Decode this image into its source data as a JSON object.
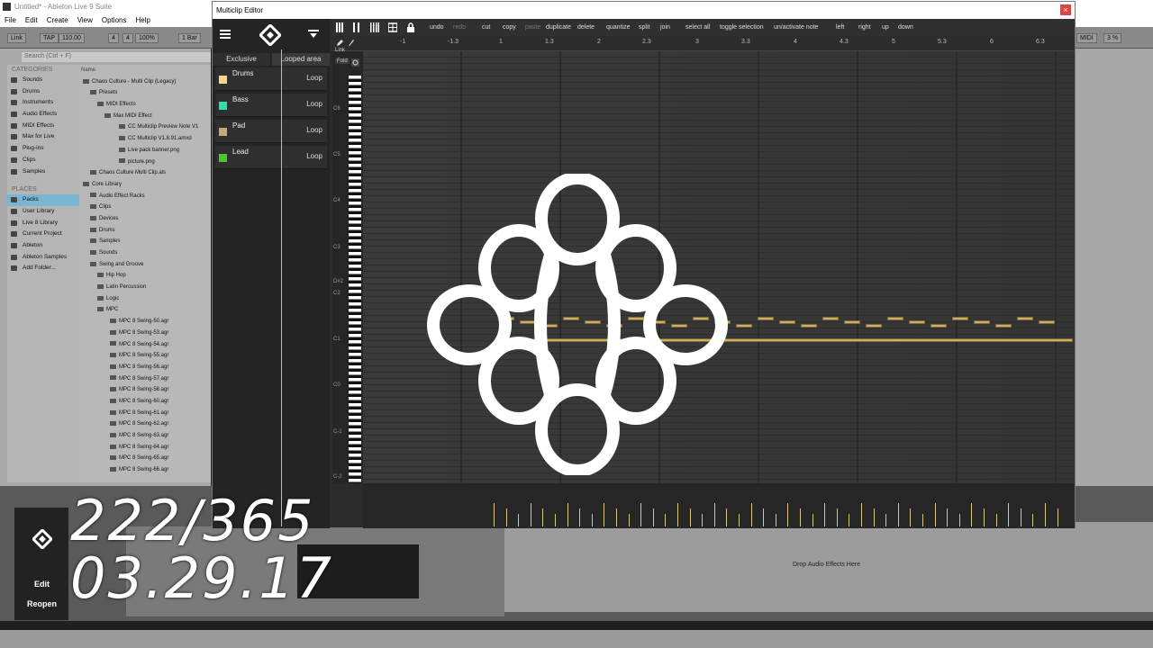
{
  "window": {
    "title": "Untitled* - Ableton Live 9 Suite"
  },
  "menu": [
    "File",
    "Edit",
    "Create",
    "View",
    "Options",
    "Help"
  ],
  "transport": {
    "link": "Link",
    "tap": "TAP",
    "tempo": "110.00",
    "sig_num": "4",
    "sig_den": "4",
    "swing": "100%",
    "bar": "1 Bar",
    "midi": "MIDI",
    "cpu": "3 %"
  },
  "browser": {
    "search_placeholder": "Search (Ctrl + F)",
    "categories_title": "CATEGORIES",
    "categories": [
      "Sounds",
      "Drums",
      "Instruments",
      "Audio Effects",
      "MIDI Effects",
      "Max for Live",
      "Plug-ins",
      "Clips",
      "Samples"
    ],
    "places_title": "PLACES",
    "places": [
      "Packs",
      "User Library",
      "Live 8 Library",
      "Current Project",
      "Ableton",
      "Ableton Samples",
      "Add Folder..."
    ],
    "col_name": "Name",
    "tree": [
      "Chaos Culture - Multi Clip (Legacy)",
      "Presets",
      "MIDI Effects",
      "Max MIDI Effect",
      "CC Multiclip Preview Note V1",
      "CC Multiclip V1.8.91.amxd",
      "Live pack banner.png",
      "picture.png",
      "Chaos Culture Multi Clip.als",
      "Core Library",
      "Audio Effect Racks",
      "Clips",
      "Devices",
      "Drums",
      "Samples",
      "Sounds",
      "Swing and Groove",
      "Hip Hop",
      "Latin Percussion",
      "Logic",
      "MPC",
      "MPC 8 Swing-50.agr",
      "MPC 8 Swing-53.agr",
      "MPC 8 Swing-54.agr",
      "MPC 8 Swing-55.agr",
      "MPC 8 Swing-56.agr",
      "MPC 8 Swing-57.agr",
      "MPC 8 Swing-58.agr",
      "MPC 8 Swing-60.agr",
      "MPC 8 Swing-61.agr",
      "MPC 8 Swing-62.agr",
      "MPC 8 Swing-63.agr",
      "MPC 8 Swing-64.agr",
      "MPC 8 Swing-65.agr",
      "MPC 8 Swing-66.agr"
    ]
  },
  "editor": {
    "title": "Multiclip Editor",
    "close": "×",
    "tab_exclusive": "Exclusive",
    "tab_looped": "Looped area",
    "tracks": [
      {
        "name": "Drums",
        "loop": "Loop",
        "color": "#f0d98a"
      },
      {
        "name": "Bass",
        "loop": "Loop",
        "color": "#2ee0a8"
      },
      {
        "name": "Pad",
        "loop": "Loop",
        "color": "#c9a77a"
      },
      {
        "name": "Lead",
        "loop": "Loop",
        "color": "#4cc92a"
      }
    ],
    "toolbar": [
      "undo",
      "redo",
      "cut",
      "copy",
      "paste",
      "duplicate",
      "delete",
      "quantize",
      "split",
      "join",
      "select all",
      "toggle selection",
      "un/activate note",
      "left",
      "right",
      "up",
      "down"
    ],
    "link": "Link",
    "fold": "Fold",
    "ruler": [
      "-1",
      "-1.3",
      "1",
      "1.3",
      "2",
      "2.3",
      "3",
      "3.3",
      "4",
      "4.3",
      "5",
      "5.3",
      "6",
      "6.3"
    ],
    "octaves": [
      "C6",
      "C5",
      "C4",
      "C3",
      "D#2",
      "C2",
      "C1",
      "C0",
      "C-1",
      "C-2"
    ]
  },
  "device": {
    "drop_text": "Drop Audio Effects Here",
    "edit": "Edit",
    "reopen": "Reopen"
  },
  "overlay": {
    "day": "222/365",
    "date": "03.29.17"
  }
}
